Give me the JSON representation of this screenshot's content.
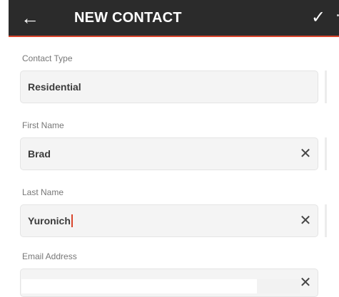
{
  "appbar": {
    "back_icon": "arrow-left-icon",
    "title": "NEW CONTACT",
    "confirm_icon": "check-icon"
  },
  "accent_color": "#d9452c",
  "form": {
    "contact_type": {
      "label": "Contact Type",
      "value": "Residential"
    },
    "first_name": {
      "label": "First Name",
      "value": "Brad",
      "clear_icon": "close-icon"
    },
    "last_name": {
      "label": "Last Name",
      "value": "Yuronich",
      "clear_icon": "close-icon"
    },
    "email": {
      "label": "Email Address",
      "value": "",
      "clear_icon": "close-icon"
    }
  }
}
